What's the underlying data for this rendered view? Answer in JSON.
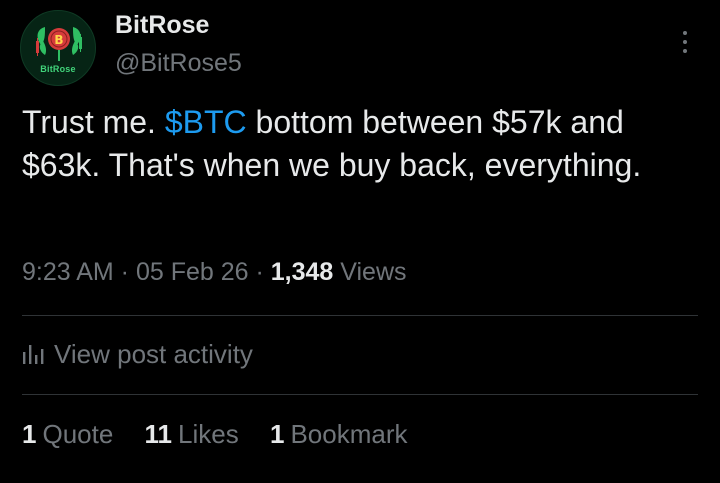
{
  "author": {
    "display_name": "BitRose",
    "handle": "@BitRose5",
    "avatar_label": "BitRose",
    "avatar_icon": "bitcoin-rose-logo-icon"
  },
  "tweet": {
    "text_before": "Trust me. ",
    "cashtag": "$BTC",
    "text_after": " bottom between $57k and $63k.  That's when we buy back, everything."
  },
  "meta": {
    "time": "9:23 AM",
    "separator1": " · ",
    "date": "05 Feb 26",
    "separator2": " · ",
    "views_count": "1,348",
    "views_label": " Views"
  },
  "activity": {
    "label": "View post activity",
    "icon": "bar-chart-icon"
  },
  "stats": {
    "quotes_count": "1",
    "quotes_label": "Quote",
    "likes_count": "11",
    "likes_label": "Likes",
    "bookmarks_count": "1",
    "bookmarks_label": "Bookmark"
  },
  "colors": {
    "background": "#000000",
    "primary_text": "#e7e9ea",
    "secondary_text": "#71767b",
    "link": "#1d9bf0",
    "divider": "#2f3336",
    "avatar_green": "#41d37a"
  }
}
